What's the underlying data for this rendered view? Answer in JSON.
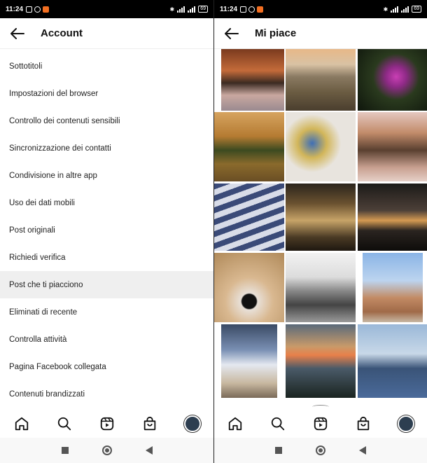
{
  "status_bar": {
    "time": "11:24",
    "battery": "69"
  },
  "left": {
    "title": "Account",
    "menu_items": [
      "Sottotitoli",
      "Impostazioni del browser",
      "Controllo dei contenuti sensibili",
      "Sincronizzazione dei contatti",
      "Condivisione in altre app",
      "Uso dei dati mobili",
      "Post originali",
      "Richiedi verifica",
      "Post che ti piacciono",
      "Eliminati di recente",
      "Controlla attività",
      "Pagina Facebook collegata",
      "Contenuti brandizzati"
    ],
    "active_index": 8
  },
  "right": {
    "title": "Mi piace"
  },
  "tabbar_icons": [
    "home-icon",
    "search-icon",
    "reels-icon",
    "shop-icon",
    "profile-avatar"
  ],
  "navbar_icons": [
    "recents-square-icon",
    "home-circle-icon",
    "back-triangle-icon"
  ],
  "colors": {
    "active_row": "#efefef",
    "text": "#222222",
    "status_bar": "#000000"
  }
}
